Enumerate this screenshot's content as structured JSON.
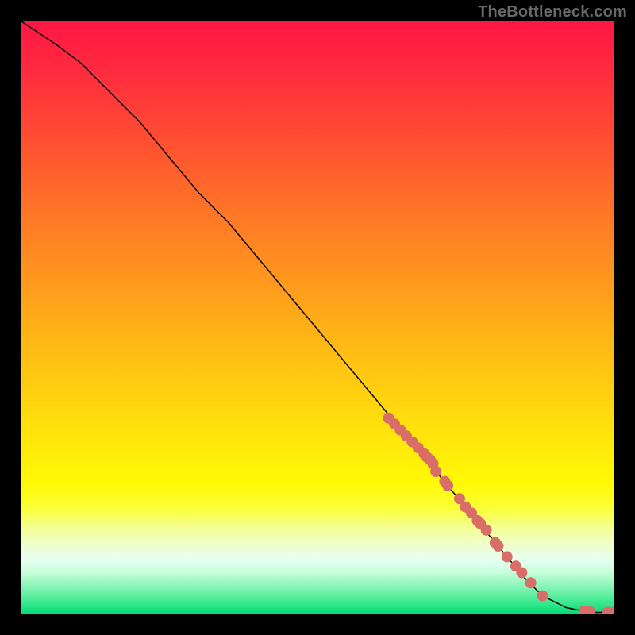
{
  "watermark": "TheBottleneck.com",
  "chart_data": {
    "type": "line",
    "title": "",
    "xlabel": "",
    "ylabel": "",
    "xlim": [
      0,
      100
    ],
    "ylim": [
      0,
      100
    ],
    "curve": {
      "name": "bottleneck-curve",
      "x": [
        0,
        3,
        6,
        10,
        15,
        20,
        25,
        30,
        35,
        40,
        45,
        50,
        55,
        60,
        65,
        70,
        75,
        80,
        85,
        88,
        90,
        92,
        94,
        95,
        97,
        100
      ],
      "y": [
        100,
        98,
        96,
        93,
        88,
        83,
        77,
        71,
        66,
        60,
        54,
        48,
        42,
        36,
        30,
        24,
        18,
        12,
        6,
        3,
        2,
        1,
        0.6,
        0.4,
        0.2,
        0.2
      ]
    },
    "highlight_points": {
      "name": "marked-range",
      "x": [
        62,
        63,
        64,
        65,
        66,
        67,
        68,
        68.5,
        69,
        69.5,
        70,
        71.5,
        72,
        74,
        75,
        76,
        77,
        77.5,
        78.5,
        80,
        80.5,
        82,
        83.5,
        84.5,
        86,
        88,
        95,
        96,
        100,
        99
      ],
      "y": [
        33,
        32,
        31,
        30,
        29,
        28,
        27,
        26.4,
        26,
        25.3,
        24,
        22.3,
        21.6,
        19.4,
        18,
        17,
        15.7,
        15.2,
        14.1,
        12,
        11.4,
        9.6,
        8,
        6.9,
        5.2,
        3,
        0.4,
        0.3,
        0.2,
        0.2
      ]
    },
    "gradient_bands": [
      {
        "y_pct": 0,
        "color": "#ff1744"
      },
      {
        "y_pct": 50,
        "color": "#ffc107"
      },
      {
        "y_pct": 85,
        "color": "#fff59d"
      },
      {
        "y_pct": 100,
        "color": "#00dc75"
      }
    ]
  }
}
